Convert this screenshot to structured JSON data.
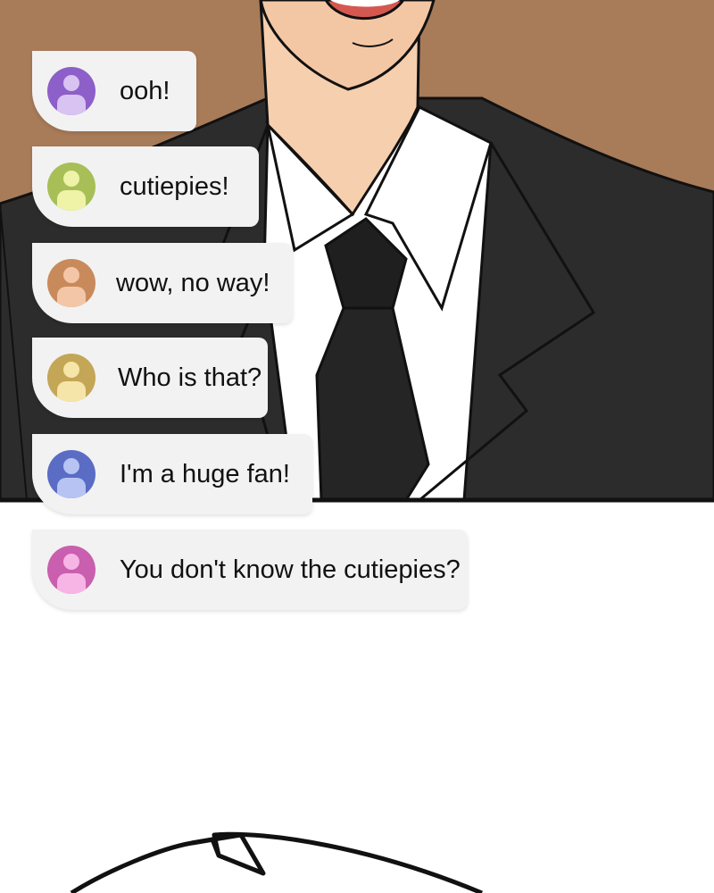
{
  "messages": [
    {
      "text": "ooh!",
      "avatar_color": "#8d5fc8",
      "avatar_light": "#d8c3f2"
    },
    {
      "text": "cutiepies!",
      "avatar_color": "#a8bf57",
      "avatar_light": "#eef3a8"
    },
    {
      "text": "wow, no way!",
      "avatar_color": "#c98a5b",
      "avatar_light": "#f4c6a8"
    },
    {
      "text": "Who is that?",
      "avatar_color": "#c4a657",
      "avatar_light": "#f6e5a8"
    },
    {
      "text": "I'm a huge fan!",
      "avatar_color": "#5a6cc4",
      "avatar_light": "#b7c3f2"
    },
    {
      "text": "You don't know the cutiepies?",
      "avatar_color": "#c95fae",
      "avatar_light": "#f7b5e6"
    }
  ],
  "colors": {
    "background_wall": "#a87b59",
    "suit": "#2c2c2c",
    "skin": "#f6cfae",
    "shirt": "#ffffff",
    "tie": "#1f1f1f",
    "bubble": "#f2f2f2"
  }
}
